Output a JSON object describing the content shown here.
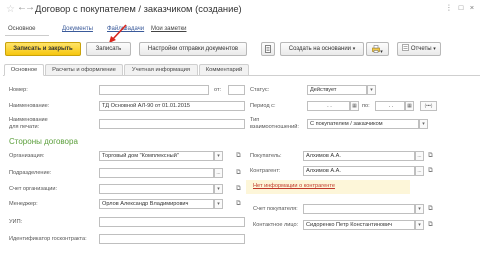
{
  "window": {
    "title": "Договор с покупателем / заказчиком (создание)",
    "favorite_glyph": "☆",
    "back_glyph": "←",
    "forward_glyph": "→",
    "menu_glyph": "⋮",
    "maximize_glyph": "□",
    "close_glyph": "×"
  },
  "nav": {
    "main": "Основное",
    "documents": "Документы",
    "files": "Файлы",
    "tasks": "Задачи",
    "notes": "Мои заметки"
  },
  "toolbar": {
    "save_close": "Записать и закрыть",
    "save": "Записать",
    "send_settings": "Настройки отправки документов",
    "create_based": "Создать на основании",
    "reports": "Отчеты",
    "caret": "▾"
  },
  "tabs": [
    "Основное",
    "Расчеты и оформление",
    "Учетная информация",
    "Комментарий"
  ],
  "form": {
    "number_label": "Номер:",
    "number_value": "",
    "from_label": "от:",
    "from_value": "",
    "name_label": "Наименование:",
    "name_value": "ТД Основной АЛ-90 от 01.01.2015",
    "print_name_label_1": "Наименование",
    "print_name_label_2": "для печати:",
    "print_name_value": "",
    "status_label": "Статус:",
    "status_value": "Действует",
    "period_label": "Период с:",
    "period_from": ". .",
    "period_to_label": "по:",
    "period_to": ". .",
    "relation_label_1": "Тип",
    "relation_label_2": "взаимоотношений:",
    "relation_value": "С покупателем / заказчиком",
    "parties_header": "Стороны договора",
    "org_label": "Организация:",
    "org_value": "Торговый дом \"Комплексный\"",
    "dept_label": "Подразделение:",
    "dept_value": "",
    "org_account_label": "Счет организации:",
    "org_account_value": "",
    "manager_label": "Менеджер:",
    "manager_value": "Орлов Александр Владимирович",
    "uip_label": "УИП:",
    "uip_value": "",
    "gov_id_label": "Идентификатор госконтракта:",
    "gov_id_value": "",
    "buyer_label": "Покупатель:",
    "buyer_value": "Алхимов А.А.",
    "counterparty_label": "Контрагент:",
    "counterparty_value": "Алхимов А.А.",
    "no_info": "Нет информации о контрагенте",
    "buyer_account_label": "Счет покупателя:",
    "buyer_account_value": "",
    "contact_label": "Контактное лицо:",
    "contact_value": "Сидоренко Петр Константинович",
    "dots": "...",
    "caret": "▾",
    "link_glyph": "⧉",
    "period_glyph": "(•••)"
  },
  "colors": {
    "accent_yellow": "#f6c60e",
    "section_green": "#5a9e3a",
    "warn_red": "#c0392b",
    "arrow_red": "#d9251c"
  }
}
